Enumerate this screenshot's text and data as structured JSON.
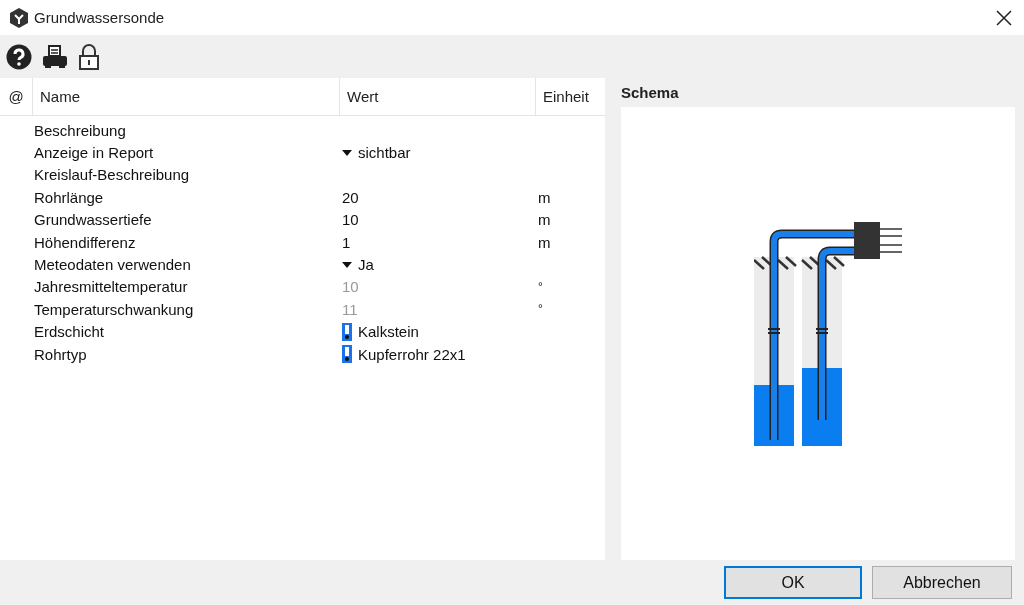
{
  "window": {
    "title": "Grundwassersonde"
  },
  "toolbar": {
    "buttons": [
      {
        "kind": "help"
      },
      {
        "kind": "print"
      },
      {
        "kind": "lock"
      }
    ]
  },
  "table": {
    "columns": [
      "@",
      "Name",
      "Wert",
      "Einheit"
    ],
    "rows": [
      {
        "kind": "text",
        "name": "Beschreibung"
      },
      {
        "kind": "dropdown",
        "name": "Anzeige in Report",
        "value": "sichtbar",
        "disabled": false
      },
      {
        "kind": "text",
        "name": "Kreislauf-Beschreibung"
      },
      {
        "kind": "text",
        "name": "Rohrlänge",
        "value": "20",
        "unit": "m",
        "disabled": false
      },
      {
        "kind": "text",
        "name": "Grundwassertiefe",
        "value": "10",
        "unit": "m",
        "disabled": false
      },
      {
        "kind": "text",
        "name": "Höhendifferenz",
        "value": "1",
        "unit": "m",
        "disabled": false
      },
      {
        "kind": "dropdown",
        "name": "Meteodaten verwenden",
        "value": "Ja",
        "disabled": false
      },
      {
        "kind": "text",
        "name": "Jahresmitteltemperatur",
        "value": "10",
        "unit": "°",
        "disabled": true
      },
      {
        "kind": "text",
        "name": "Temperaturschwankung",
        "value": "11",
        "unit": "°",
        "disabled": true
      },
      {
        "kind": "catalog",
        "name": "Erdschicht",
        "value": "Kalkstein",
        "disabled": false
      },
      {
        "kind": "catalog",
        "name": "Rohrtyp",
        "value": "Kupferrohr 22x1",
        "disabled": false
      }
    ]
  },
  "schema": {
    "title": "Schema"
  },
  "buttons": [
    {
      "label": "OK",
      "selected": true
    },
    {
      "label": "Abbrechen",
      "selected": false
    }
  ]
}
